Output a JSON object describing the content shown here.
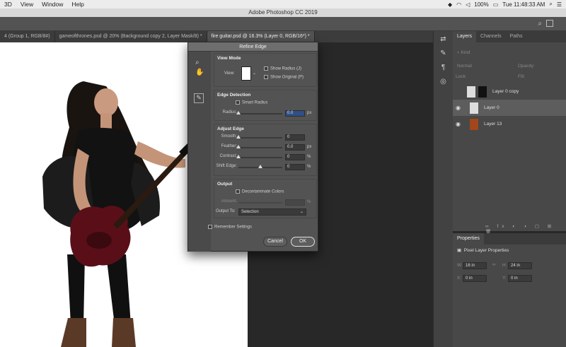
{
  "menubar": {
    "items": [
      "3D",
      "View",
      "Window",
      "Help"
    ],
    "status": {
      "battery": "100%",
      "clock": "Tue 11:48:33 AM"
    }
  },
  "window": {
    "title": "Adobe Photoshop CC 2019"
  },
  "doc_tabs": [
    {
      "label": "4 (Group 1, RGB/8#)",
      "active": false
    },
    {
      "label": "gameofthrones.psd @ 20% (Background copy 2, Layer Mask/8) *",
      "active": false
    },
    {
      "label": "fire guitar.psd @ 16.3% (Layer 0, RGB/16*) *",
      "active": true
    }
  ],
  "layers_panel": {
    "tabs": [
      "Layers",
      "Channels",
      "Paths"
    ],
    "kind_label": "Kind",
    "blend_mode": "Normal",
    "opacity_label": "Opacity:",
    "lock_label": "Lock:",
    "fill_label": "Fill:",
    "layers": [
      {
        "name": "Layer 0 copy",
        "selected": false,
        "visible": false
      },
      {
        "name": "Layer 0",
        "selected": true,
        "visible": true
      },
      {
        "name": "Layer 13",
        "selected": false,
        "visible": true
      }
    ]
  },
  "properties_panel": {
    "title": "Properties",
    "section": "Pixel Layer Properties",
    "w_label": "W:",
    "w_value": "16 in",
    "h_label": "H:",
    "h_value": "24 in",
    "x_label": "X:",
    "x_value": "0 in",
    "y_label": "Y:",
    "y_value": "0 in"
  },
  "refine_edge": {
    "title": "Refine Edge",
    "view_mode": {
      "heading": "View Mode",
      "view_label": "View:",
      "show_radius": "Show Radius (J)",
      "show_original": "Show Original (P)"
    },
    "edge_detection": {
      "heading": "Edge Detection",
      "smart_radius": "Smart Radius",
      "radius_label": "Radius:",
      "radius_value": "0.0",
      "radius_unit": "px"
    },
    "adjust_edge": {
      "heading": "Adjust Edge",
      "smooth_label": "Smooth:",
      "smooth_value": "0",
      "feather_label": "Feather:",
      "feather_value": "0.0",
      "feather_unit": "px",
      "contrast_label": "Contrast:",
      "contrast_value": "0",
      "contrast_unit": "%",
      "shift_label": "Shift Edge:",
      "shift_value": "0",
      "shift_unit": "%"
    },
    "output": {
      "heading": "Output",
      "decontaminate": "Decontaminate Colors",
      "amount_label": "Amount:",
      "amount_unit": "%",
      "output_to_label": "Output To:",
      "output_to_value": "Selection"
    },
    "remember": "Remember Settings",
    "cancel": "Cancel",
    "ok": "OK"
  }
}
